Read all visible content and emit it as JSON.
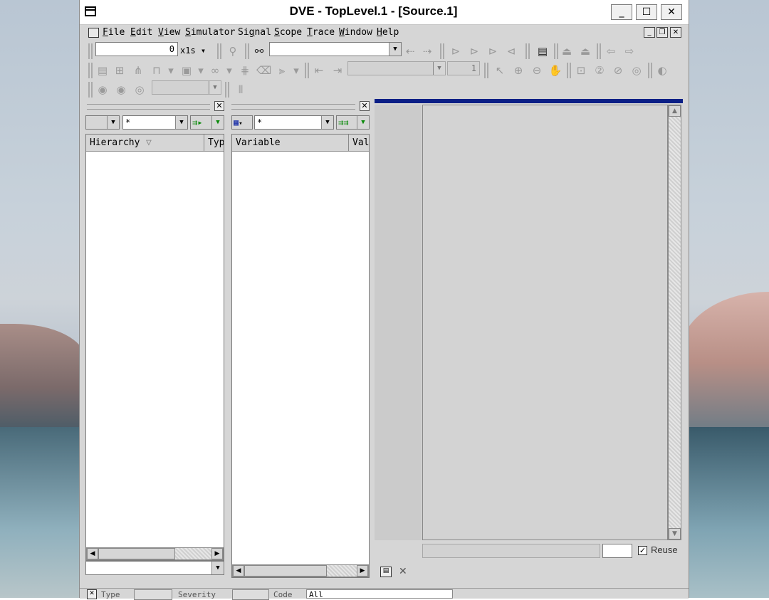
{
  "window": {
    "title": "DVE - TopLevel.1 - [Source.1]"
  },
  "titlebar": {
    "minimize": "_",
    "maximize": "☐",
    "close": "✕"
  },
  "menubar": {
    "items": [
      {
        "label": "File",
        "key": "F",
        "rest": "ile"
      },
      {
        "label": "Edit",
        "key": "E",
        "rest": "dit"
      },
      {
        "label": "View",
        "key": "V",
        "rest": "iew"
      },
      {
        "label": "Simulator",
        "key": "S",
        "rest": "imulator"
      },
      {
        "label": "Signal",
        "key": "g",
        "rest": ""
      },
      {
        "label": "Scope",
        "key": "S",
        "rest": "cope"
      },
      {
        "label": "Trace",
        "key": "T",
        "rest": "race"
      },
      {
        "label": "Window",
        "key": "W",
        "rest": "indow"
      },
      {
        "label": "Help",
        "key": "H",
        "rest": "elp"
      }
    ]
  },
  "toolbar1": {
    "time_value": "0",
    "time_unit": "x1s",
    "search_value": ""
  },
  "toolbar2": {
    "step_value": "1"
  },
  "hierarchy_panel": {
    "filter_value": "*",
    "columns": [
      "Hierarchy",
      "Type"
    ]
  },
  "data_panel": {
    "filter_value": "*",
    "columns": [
      "Variable",
      "Value"
    ]
  },
  "source_panel": {
    "reuse_label": "Reuse",
    "reuse_checked": true
  },
  "bottom": {
    "labels": [
      "Type",
      "Severity",
      "Code",
      "All"
    ]
  }
}
